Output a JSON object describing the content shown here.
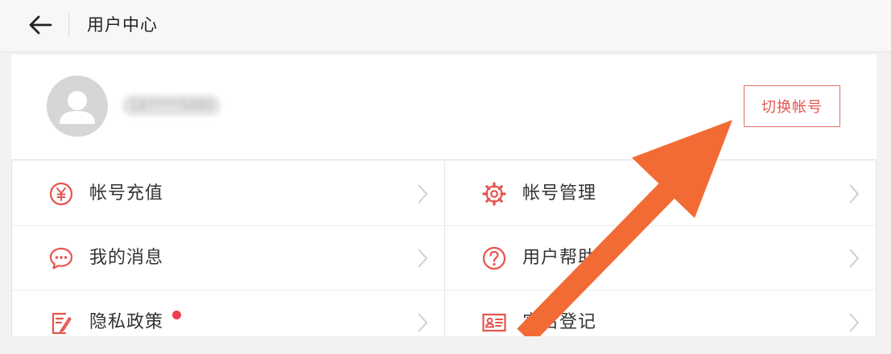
{
  "header": {
    "title": "用户中心",
    "back_icon": "arrow-left-icon"
  },
  "profile": {
    "username": "187****5680",
    "switch_label": "切换帐号"
  },
  "menu": {
    "items": [
      {
        "label": "帐号充值",
        "icon": "yen-coin-icon"
      },
      {
        "label": "帐号管理",
        "icon": "gear-icon"
      },
      {
        "label": "我的消息",
        "icon": "chat-bubble-icon"
      },
      {
        "label": "用户帮助",
        "icon": "question-circle-icon"
      },
      {
        "label": "隐私政策",
        "icon": "document-edit-icon",
        "badge": "red-dot"
      },
      {
        "label": "实名登记",
        "icon": "id-card-icon"
      }
    ]
  },
  "colors": {
    "accent": "#e5544e",
    "annotation_arrow": "#f26b35",
    "badge": "#ee3f4d"
  }
}
